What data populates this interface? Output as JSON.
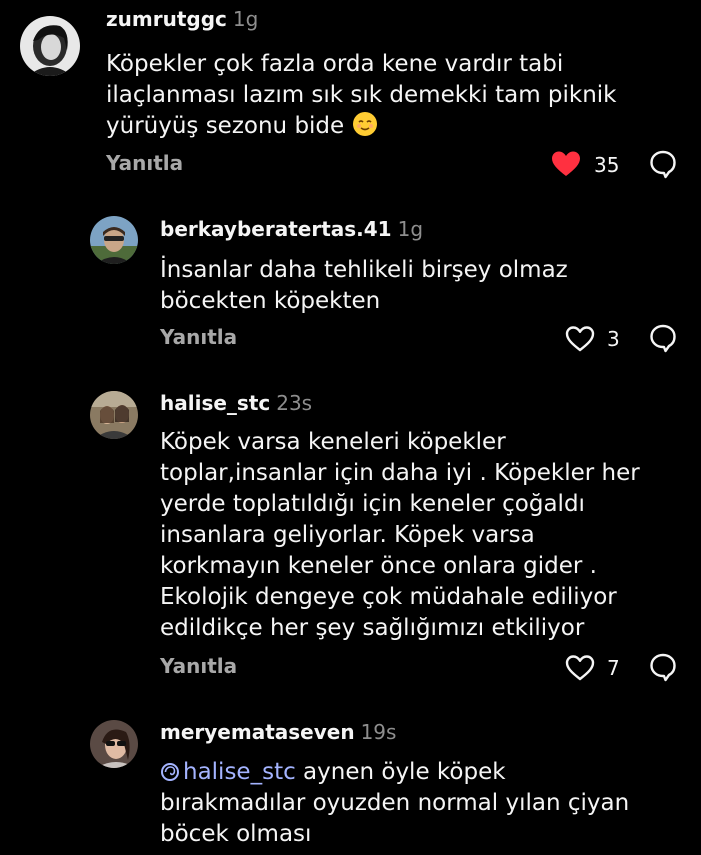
{
  "comments": [
    {
      "username": "zumrutggc",
      "time": "1g",
      "text_line1": "Köpekler çok fazla orda kene vardır tabi",
      "text_line2": "ilaçlanması lazım sık sık demekki  tam piknik",
      "text_line3": "yürüyüş sezonu bide",
      "emoji": "warm-smile-emoji",
      "reply_label": "Yanıtla",
      "likes": "35",
      "liked": true
    },
    {
      "username": "berkayberatertas.41",
      "time": "1g",
      "text_line1": "İnsanlar daha tehlikeli birşey olmaz",
      "text_line2": "böcekten köpekten",
      "reply_label": "Yanıtla",
      "likes": "3",
      "liked": false
    },
    {
      "username": "halise_stc",
      "time": "23s",
      "text_line1": "Köpek varsa keneleri köpekler",
      "text_line2": "toplar,insanlar için daha iyi . Köpekler her",
      "text_line3": "yerde toplatıldığı için keneler çoğaldı",
      "text_line4": "insanlara geliyorlar. Köpek varsa",
      "text_line5": "korkmayın keneler önce onlara gider .",
      "text_line6": "Ekolojik dengeye çok müdahale ediliyor",
      "text_line7": "edildikçe her şey sağlığımızı etkiliyor",
      "reply_label": "Yanıtla",
      "likes": "7",
      "liked": false
    },
    {
      "username": "meryemataseven",
      "time": "19s",
      "mention": "halise_stc",
      "text_line1": " aynen öyle köpek",
      "text_line2": "bırakmadılar oyuzden normal yılan çiyan",
      "text_line3": "böcek olması"
    }
  ],
  "colors": {
    "background": "#000000",
    "text": "#f5f5f5",
    "muted": "#8e8e8e",
    "like_active": "#ff3040",
    "mention": "#a4b4ff"
  }
}
